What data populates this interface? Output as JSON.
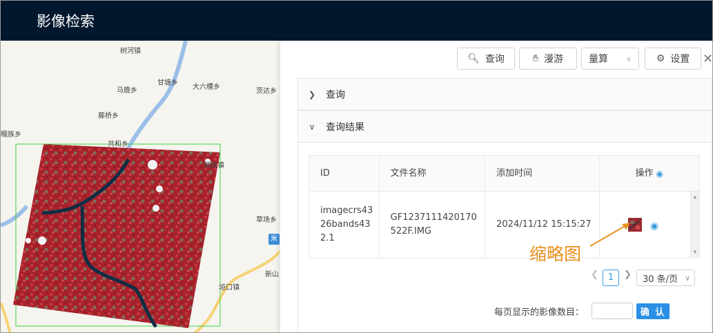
{
  "header": {
    "title": "影像检索"
  },
  "map": {
    "places": [
      "树河镇",
      "甘塘乡",
      "大六槽乡",
      "马鹿乡",
      "茨达乡",
      "藤桥乡",
      "共和乡",
      "普威镇",
      "糯族乡",
      "草场乡",
      "垭口镇",
      "新山"
    ],
    "badge": "米"
  },
  "toolbar": {
    "query_label": "查询",
    "roam_label": "漫游",
    "measure_label": "量算",
    "settings_label": "设置"
  },
  "sections": {
    "query": "查询",
    "results": "查询结果"
  },
  "table": {
    "columns": [
      "ID",
      "文件名称",
      "添加时间",
      "操作"
    ],
    "rows": [
      {
        "id": "imagecrs4326bands432.1",
        "filename": "GF1237111420170522F.IMG",
        "added": "2024/11/12 15:15:27"
      }
    ]
  },
  "annotation": {
    "text": "缩略图",
    "color": "#e8911e"
  },
  "pagination": {
    "current_page": "1",
    "page_size": "30 条/页"
  },
  "per_page_form": {
    "label": "每页显示的影像数目：",
    "value": "",
    "confirm": "确 认"
  },
  "colors": {
    "header_bg": "#01172e",
    "accent": "#2b8fe6",
    "footprint": "#3cd63c"
  }
}
